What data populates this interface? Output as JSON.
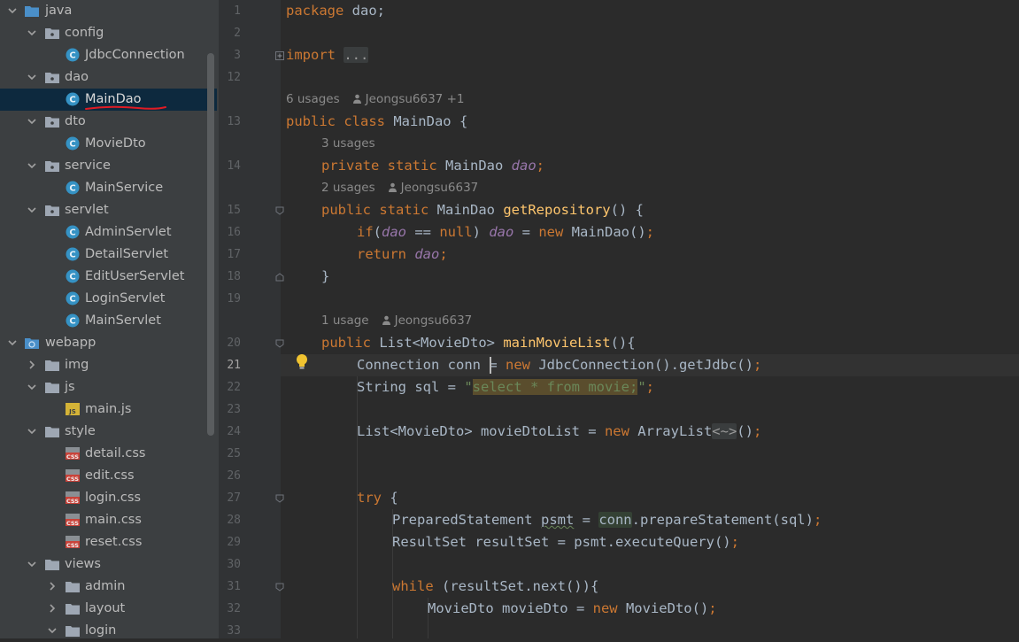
{
  "tree": {
    "items": [
      {
        "label": "java",
        "depth": 0,
        "type": "folder-blue",
        "expanded": true
      },
      {
        "label": "config",
        "depth": 1,
        "type": "package",
        "expanded": true
      },
      {
        "label": "JdbcConnection",
        "depth": 2,
        "type": "class"
      },
      {
        "label": "dao",
        "depth": 1,
        "type": "package",
        "expanded": true
      },
      {
        "label": "MainDao",
        "depth": 2,
        "type": "class",
        "selected": true
      },
      {
        "label": "dto",
        "depth": 1,
        "type": "package",
        "expanded": true
      },
      {
        "label": "MovieDto",
        "depth": 2,
        "type": "class"
      },
      {
        "label": "service",
        "depth": 1,
        "type": "package",
        "expanded": true
      },
      {
        "label": "MainService",
        "depth": 2,
        "type": "class"
      },
      {
        "label": "servlet",
        "depth": 1,
        "type": "package",
        "expanded": true
      },
      {
        "label": "AdminServlet",
        "depth": 2,
        "type": "class"
      },
      {
        "label": "DetailServlet",
        "depth": 2,
        "type": "class"
      },
      {
        "label": "EditUserServlet",
        "depth": 2,
        "type": "class"
      },
      {
        "label": "LoginServlet",
        "depth": 2,
        "type": "class"
      },
      {
        "label": "MainServlet",
        "depth": 2,
        "type": "class"
      },
      {
        "label": "webapp",
        "depth": 0,
        "type": "web-folder",
        "expanded": true
      },
      {
        "label": "img",
        "depth": 1,
        "type": "folder",
        "expanded": false
      },
      {
        "label": "js",
        "depth": 1,
        "type": "folder",
        "expanded": true
      },
      {
        "label": "main.js",
        "depth": 2,
        "type": "js"
      },
      {
        "label": "style",
        "depth": 1,
        "type": "folder",
        "expanded": true
      },
      {
        "label": "detail.css",
        "depth": 2,
        "type": "css"
      },
      {
        "label": "edit.css",
        "depth": 2,
        "type": "css"
      },
      {
        "label": "login.css",
        "depth": 2,
        "type": "css"
      },
      {
        "label": "main.css",
        "depth": 2,
        "type": "css"
      },
      {
        "label": "reset.css",
        "depth": 2,
        "type": "css"
      },
      {
        "label": "views",
        "depth": 1,
        "type": "folder",
        "expanded": true
      },
      {
        "label": "admin",
        "depth": 2,
        "type": "folder",
        "expanded": false
      },
      {
        "label": "layout",
        "depth": 2,
        "type": "folder",
        "expanded": false
      },
      {
        "label": "login",
        "depth": 2,
        "type": "folder",
        "expanded": true
      }
    ]
  },
  "icons": {
    "class_letter": "C",
    "js_badge": "JS",
    "css_badge": "CSS"
  },
  "editor": {
    "line_numbers": [
      "1",
      "2",
      "3",
      "12",
      "",
      "13",
      "",
      "14",
      "",
      "15",
      "16",
      "17",
      "18",
      "19",
      "",
      "20",
      "21",
      "22",
      "23",
      "24",
      "25",
      "26",
      "27",
      "28",
      "29",
      "30",
      "31",
      "32",
      "33"
    ],
    "current_line": "21",
    "code": {
      "l1_kw": "package",
      "l1_rest": " dao;",
      "l3_kw": "import",
      "l3_fold": "...",
      "hint1_usages": "6 usages",
      "hint1_author": "Jeongsu6637 +1",
      "l13_kw": "public class",
      "l13_rest": " MainDao {",
      "hint2_usages": "3 usages",
      "l14_kw": "private static",
      "l14_type": " MainDao ",
      "l14_field": "dao",
      "l14_semi": ";",
      "hint3_usages": "2 usages",
      "hint3_author": "Jeongsu6637",
      "l15_kw": "public static",
      "l15_type": " MainDao ",
      "l15_fn": "getRepository",
      "l15_rest": "() {",
      "l16_kw1": "if",
      "l16_p1": "(",
      "l16_f1": "dao",
      "l16_op": " == ",
      "l16_kw2": "null",
      "l16_p2": ") ",
      "l16_f2": "dao",
      "l16_eq": " = ",
      "l16_kw3": "new",
      "l16_rest": " MainDao()",
      "l16_semi": ";",
      "l17_kw": "return",
      "l17_f": "dao",
      "l17_semi": ";",
      "l18": "}",
      "hint4_usages": "1 usage",
      "hint4_author": "Jeongsu6637",
      "l20_kw": "public",
      "l20_type": " List<MovieDto> ",
      "l20_fn": "mainMovieList",
      "l20_rest": "(){",
      "l21_a": "Connection conn",
      "l21_eq": " = ",
      "l21_kw": "new",
      "l21_rest": " JdbcConnection().getJdbc()",
      "l21_semi": ";",
      "l22_a": "String sql = ",
      "l22_q1": "\"",
      "l22_inj": "select * from movie;",
      "l22_q2": "\"",
      "l22_semi": ";",
      "l24_a": "List<MovieDto> movieDtoList = ",
      "l24_kw": "new",
      "l24_b": " ArrayList",
      "l24_diamond": "<~>",
      "l24_c": "()",
      "l24_semi": ";",
      "l27_kw": "try",
      "l27_rest": " {",
      "l28_a": "PreparedStatement ",
      "l28_var": "psmt",
      "l28_b": " = ",
      "l28_conn": "conn",
      "l28_c": ".prepareStatement(sql)",
      "l28_semi": ";",
      "l29_a": "ResultSet resultSet = psmt.executeQuery()",
      "l29_semi": ";",
      "l31_kw": "while",
      "l31_rest": " (resultSet.next()){",
      "l32_a": "MovieDto movieDto = ",
      "l32_kw": "new",
      "l32_b": " MovieDto()",
      "l32_semi": ";"
    }
  },
  "colors": {
    "keyword": "#cc7832",
    "field": "#9876aa",
    "method": "#ffc66d",
    "string": "#6a8759",
    "text": "#a9b7c6",
    "selection": "#0d293e",
    "annotation_red": "#e01b24"
  }
}
